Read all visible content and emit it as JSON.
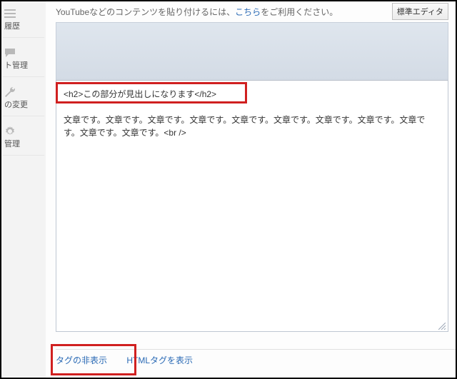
{
  "sidebar": {
    "items": [
      {
        "label": "履歴"
      },
      {
        "label": "ト管理"
      },
      {
        "label": "の変更"
      },
      {
        "label": "管理"
      }
    ]
  },
  "hint": {
    "prefix": "YouTubeなどのコンテンツを貼り付けるには、",
    "link_text": "こちら",
    "suffix": "をご利用ください。"
  },
  "buttons": {
    "editor_toggle": "標準エディタ"
  },
  "editor": {
    "line1": "<h2>この部分が見出しになります</h2>",
    "line3": "文章です。文章です。文章です。文章です。文章です。文章です。文章です。文章です。文章です。文章です。文章です。<br />"
  },
  "footer": {
    "hide_tags": "タグの非表示",
    "show_html": "HTMLタグを表示"
  }
}
